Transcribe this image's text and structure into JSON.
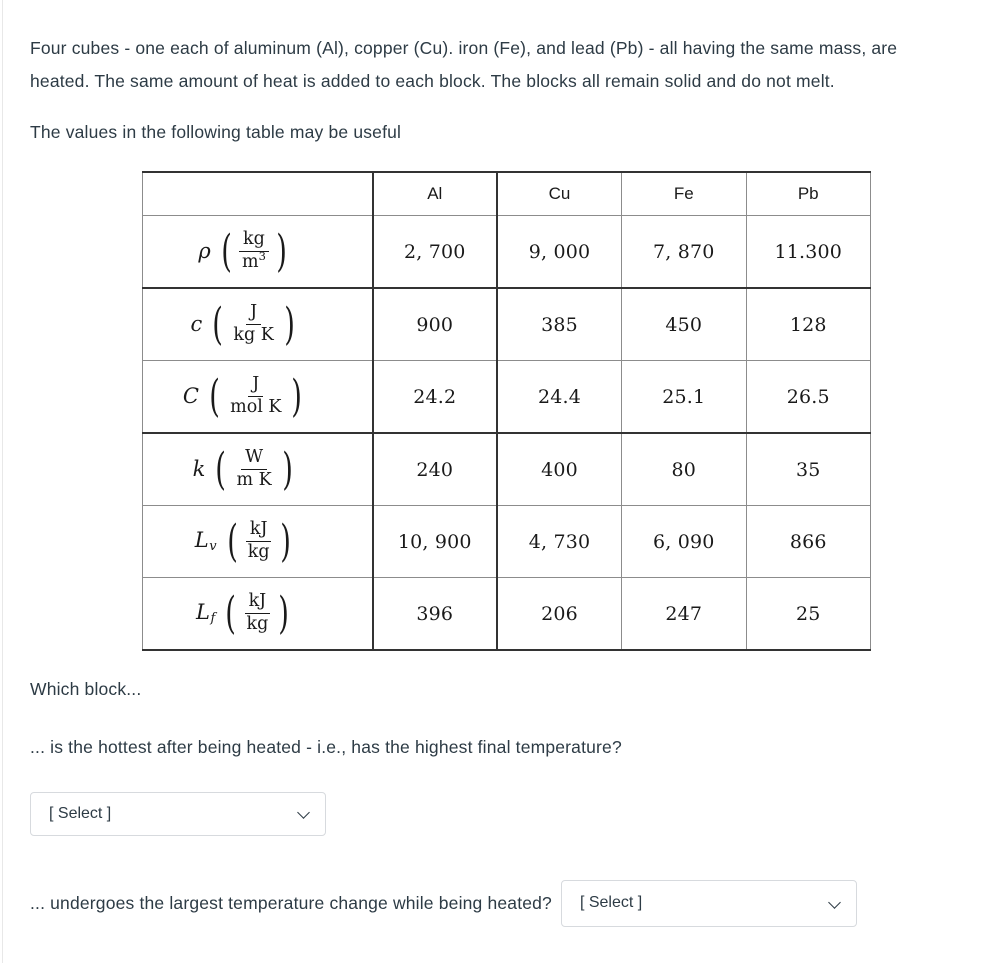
{
  "intro": {
    "paragraph": "Four cubes - one each of aluminum (Al), copper (Cu). iron (Fe), and lead (Pb) - all having the same mass, are heated. The same amount of heat is added to each block. The blocks all remain solid and do not melt.",
    "table_intro": "The values in the following table may be useful"
  },
  "table": {
    "corner_label": "",
    "columns": [
      "Al",
      "Cu",
      "Fe",
      "Pb"
    ],
    "rows": [
      {
        "symbol": "ρ",
        "subscript": "",
        "unit_numerator": "kg",
        "unit_denominator": "m",
        "unit_denominator_sup": "3",
        "values": [
          "2, 700",
          "9, 000",
          "7, 870",
          "11.300"
        ]
      },
      {
        "symbol": "c",
        "subscript": "",
        "unit_numerator": "J",
        "unit_denominator": "kg K",
        "unit_denominator_sup": "",
        "values": [
          "900",
          "385",
          "450",
          "128"
        ]
      },
      {
        "symbol": "C",
        "subscript": "",
        "unit_numerator": "J",
        "unit_denominator": "mol K",
        "unit_denominator_sup": "",
        "values": [
          "24.2",
          "24.4",
          "25.1",
          "26.5"
        ]
      },
      {
        "symbol": "k",
        "subscript": "",
        "unit_numerator": "W",
        "unit_denominator": "m K",
        "unit_denominator_sup": "",
        "values": [
          "240",
          "400",
          "80",
          "35"
        ]
      },
      {
        "symbol": "L",
        "subscript": "v",
        "unit_numerator": "kJ",
        "unit_denominator": "kg",
        "unit_denominator_sup": "",
        "values": [
          "10, 900",
          "4, 730",
          "6, 090",
          "866"
        ]
      },
      {
        "symbol": "L",
        "subscript": "f",
        "unit_numerator": "kJ",
        "unit_denominator": "kg",
        "unit_denominator_sup": "",
        "values": [
          "396",
          "206",
          "247",
          "25"
        ]
      }
    ]
  },
  "questions": {
    "lead_in": "Which block...",
    "q1": {
      "text": "... is the hottest after being heated - i.e., has the highest final temperature?",
      "select_value": "[ Select ]"
    },
    "q2": {
      "text": "... undergoes the largest temperature change while being heated?",
      "select_value": "[ Select ]"
    }
  },
  "colors": {
    "text": "#2d3b45",
    "table_border": "#8c8c8c",
    "table_rule_thick": "#333333",
    "select_border": "#d7dade"
  }
}
